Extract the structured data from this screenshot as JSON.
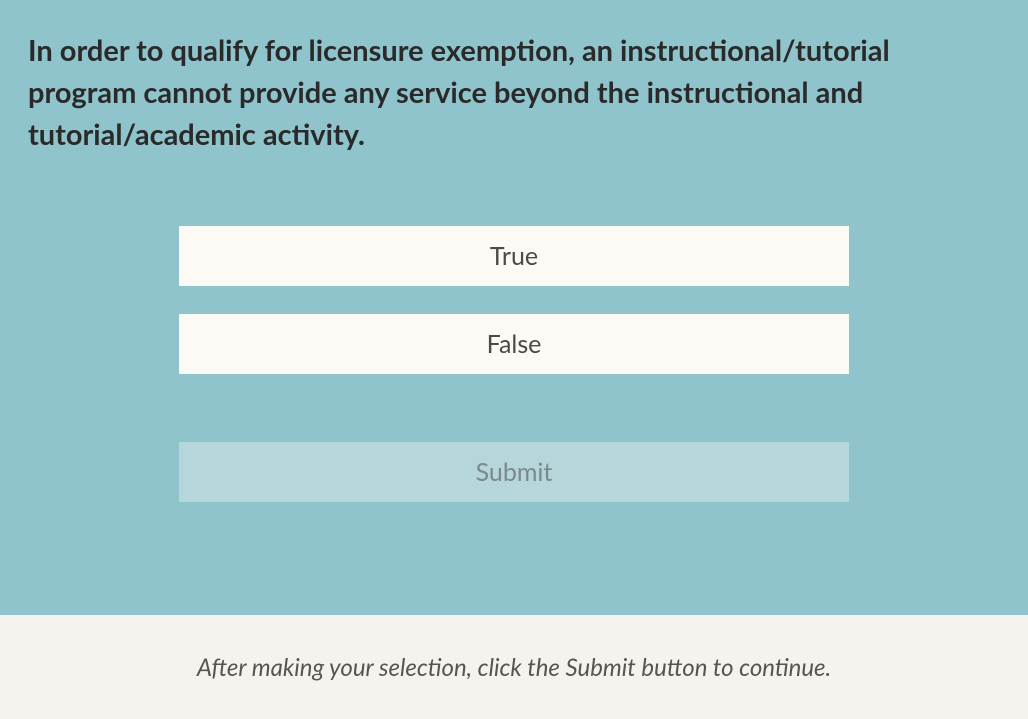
{
  "question": {
    "text": "In order to qualify for licensure exemption, an instructional/tutorial program cannot provide any service beyond the instructional and tutorial/academic activity."
  },
  "options": [
    {
      "label": "True"
    },
    {
      "label": "False"
    }
  ],
  "submit": {
    "label": "Submit"
  },
  "footer": {
    "instruction": "After making your selection, click the Submit button to continue."
  }
}
